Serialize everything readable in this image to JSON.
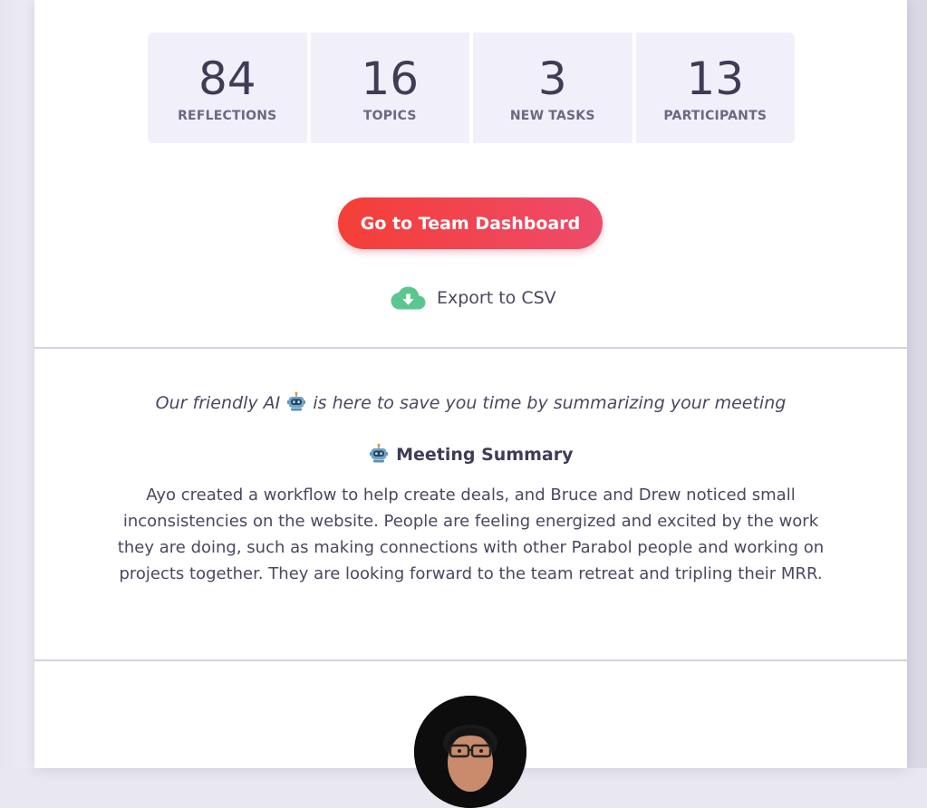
{
  "stats": [
    {
      "value": "84",
      "label": "REFLECTIONS"
    },
    {
      "value": "16",
      "label": "TOPICS"
    },
    {
      "value": "3",
      "label": "NEW TASKS"
    },
    {
      "value": "13",
      "label": "PARTICIPANTS"
    }
  ],
  "actions": {
    "dashboard_label": "Go to Team Dashboard",
    "export_label": "Export to CSV"
  },
  "ai": {
    "intro_before": "Our friendly AI",
    "intro_after": "is here to save you time by summarizing your meeting",
    "summary_title": "Meeting Summary",
    "summary_text": "Ayo created a workflow to help create deals, and Bruce and Drew noticed small inconsistencies on the website. People are feeling energized and excited by the work they are doing, such as making connections with other Parabol people and working on projects together. They are looking forward to the team retreat and tripling their MRR."
  },
  "colors": {
    "accent_start": "#f43f37",
    "accent_end": "#ee4a6b",
    "export_icon": "#5cc68f",
    "stat_bg": "#f1f0fa"
  },
  "icons": {
    "export": "cloud-download-icon",
    "robot": "robot-icon",
    "avatar": "user-avatar"
  }
}
